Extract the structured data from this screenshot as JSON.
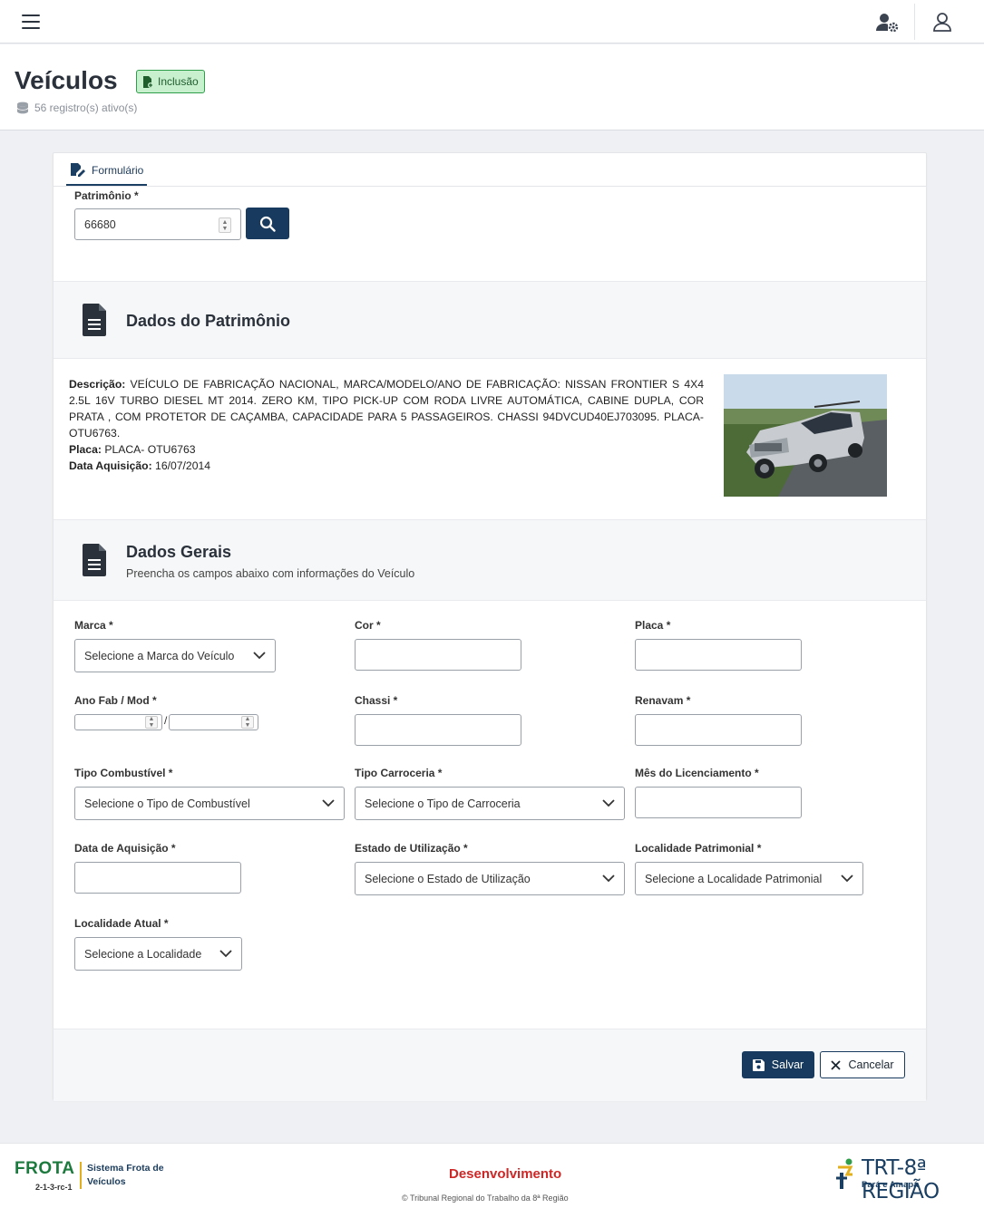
{
  "topbar": {
    "menu_icon": "hamburger-icon",
    "user_settings_icon": "user-gear-icon",
    "user_icon": "user-icon"
  },
  "header": {
    "title": "Veículos",
    "badge": "Inclusão",
    "badge_icon": "file-add-icon",
    "records": "56 registro(s) ativo(s)",
    "records_icon": "database-icon"
  },
  "tabs": [
    {
      "label": "Formulário",
      "icon": "edit-form-icon"
    }
  ],
  "patrimonio": {
    "label": "Patrimônio *",
    "value": "66680"
  },
  "dados_patrimonio": {
    "title": "Dados do Patrimônio",
    "descricao_label": "Descrição:",
    "descricao": "VEÍCULO DE FABRICAÇÃO NACIONAL, MARCA/MODELO/ANO DE FABRICAÇÃO: NISSAN FRONTIER S 4X4 2.5L 16V TURBO DIESEL MT 2014. ZERO KM, TIPO PICK-UP COM RODA LIVRE AUTOMÁTICA, CABINE DUPLA, COR PRATA , COM PROTETOR DE CAÇAMBA, CAPACIDADE PARA 5 PASSAGEIROS. CHASSI 94DVCUD40EJ703095. PLACA- OTU6763.",
    "placa_label": "Placa:",
    "placa": "PLACA- OTU6763",
    "data_label": "Data Aquisição:",
    "data": "16/07/2014"
  },
  "dados_gerais": {
    "title": "Dados Gerais",
    "subtitle": "Preencha os campos abaixo com informações do Veículo"
  },
  "fields": {
    "marca": {
      "label": "Marca *",
      "placeholder": "Selecione a Marca do Veículo"
    },
    "cor": {
      "label": "Cor *"
    },
    "placa": {
      "label": "Placa *"
    },
    "ano": {
      "label": "Ano Fab / Mod *",
      "sep": "/"
    },
    "chassi": {
      "label": "Chassi *"
    },
    "renavam": {
      "label": "Renavam *"
    },
    "combustivel": {
      "label": "Tipo Combustível *",
      "placeholder": "Selecione o Tipo de Combustível"
    },
    "carroceria": {
      "label": "Tipo Carroceria *",
      "placeholder": "Selecione o Tipo de Carroceria"
    },
    "licenciamento": {
      "label": "Mês do Licenciamento *"
    },
    "aquisicao": {
      "label": "Data de Aquisição *"
    },
    "estado": {
      "label": "Estado de Utilização *",
      "placeholder": "Selecione o Estado de Utilização"
    },
    "loc_patrimonial": {
      "label": "Localidade Patrimonial *",
      "placeholder": "Selecione a Localidade Patrimonial"
    },
    "loc_atual": {
      "label": "Localidade Atual *",
      "placeholder": "Selecione a Localidade"
    }
  },
  "actions": {
    "save": "Salvar",
    "cancel": "Cancelar"
  },
  "footer": {
    "brand": "FROTA",
    "version": "2-1-3-rc-1",
    "system": "Sistema Frota de Veículos",
    "environment": "Desenvolvimento",
    "copyright": "© Tribunal Regional do Trabalho da 8ª Região",
    "org": "TRT-8ª REGIÃO",
    "org_sub": "Pará e Amapá"
  },
  "colors": {
    "primary": "#173a5e",
    "badge_bg": "#c8f0cf",
    "brand_green": "#1d7a3e",
    "env_red": "#cf2626"
  }
}
